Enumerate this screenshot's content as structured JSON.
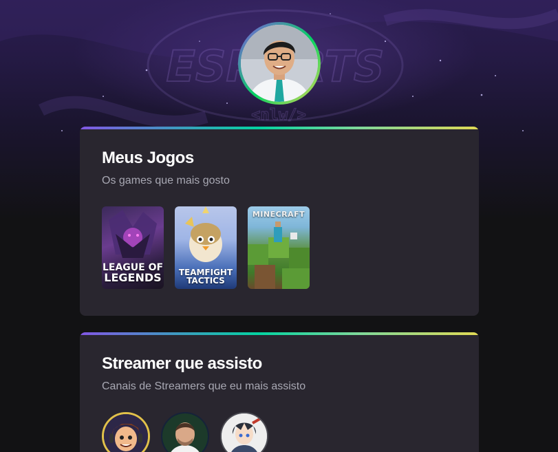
{
  "profile": {
    "avatar_icon": "profile-photo"
  },
  "background": {
    "logo_text": "ESPORTS",
    "logo_subtext": "<nlw/>"
  },
  "games_card": {
    "title": "Meus Jogos",
    "subtitle": "Os games que mais gosto",
    "games": [
      {
        "title_line1": "LEAGUE OF",
        "title_line2": "LEGENDS"
      },
      {
        "title_line1": "TEAMFIGHT",
        "title_line2": "TACTICS"
      },
      {
        "title_line1": "MINECRAFT",
        "title_line2": ""
      }
    ]
  },
  "streamers_card": {
    "title": "Streamer que assisto",
    "subtitle": "Canais de Streamers que eu mais assisto",
    "streamers": [
      {
        "avatar_icon": "streamer-avatar-cartoon"
      },
      {
        "avatar_icon": "streamer-avatar-photo"
      },
      {
        "avatar_icon": "streamer-avatar-anime"
      }
    ]
  },
  "colors": {
    "page_bg": "#121214",
    "card_bg": "#29262f",
    "accent_purple": "#8257e5",
    "accent_green": "#04d361",
    "accent_yellow": "#e1d955",
    "title": "#ffffff",
    "subtitle": "#a8a8b3"
  }
}
